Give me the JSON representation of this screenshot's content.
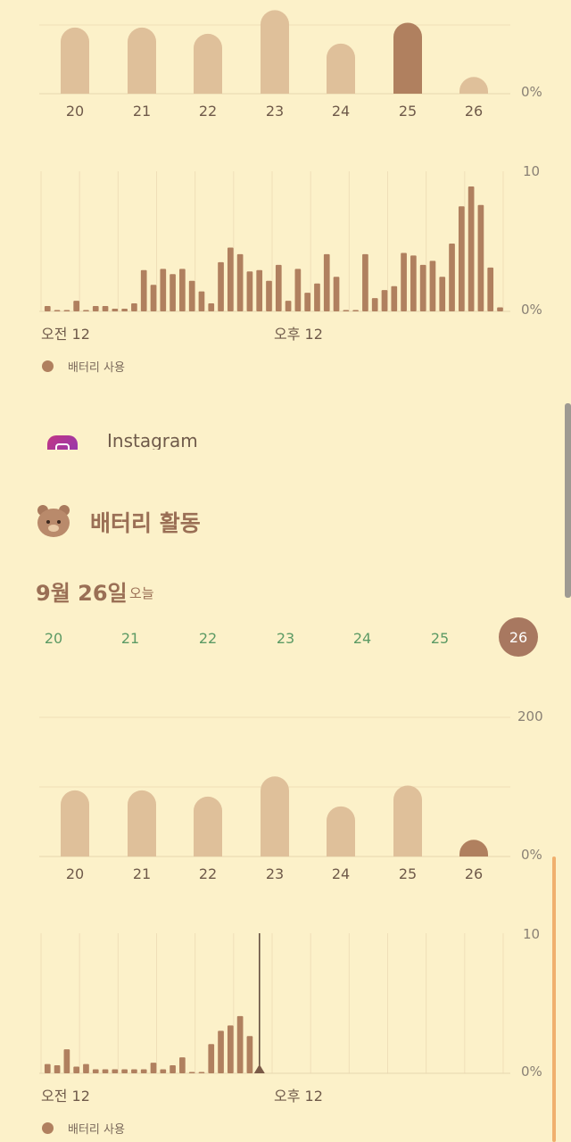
{
  "colors": {
    "background": "#fcf1c9",
    "bar_light": "#dfc09a",
    "bar_dark": "#b0805f",
    "hourly_bar": "#b0805f",
    "grid": "#efdfb8",
    "green_text": "#5c9a64",
    "accent_orange": "#f0b06e"
  },
  "top_section": {
    "weekly_chart": {
      "days": [
        "20",
        "21",
        "22",
        "23",
        "24",
        "25",
        "26"
      ],
      "values": [
        95,
        95,
        86,
        120,
        72,
        102,
        24
      ],
      "selected_index": 5,
      "max": 200,
      "y_min_label": "0%"
    },
    "hourly_chart": {
      "values": [
        0.4,
        0.1,
        0.1,
        0.8,
        0,
        0.4,
        0.4,
        0.2,
        0.2,
        0.6,
        3.1,
        2,
        3.2,
        2.8,
        3.2,
        2.3,
        1.5,
        0.6,
        3.7,
        4.8,
        4.3,
        3,
        3.1,
        2.3,
        3.5,
        0.8,
        3.2,
        1.4,
        2.1,
        4.3,
        2.6,
        0,
        0,
        4.3,
        1,
        1.6,
        1.9,
        4.4,
        4.2,
        3.5,
        3.8,
        2.6,
        5.1,
        7.9,
        9.4,
        8,
        3.3,
        0.3
      ],
      "y_max_label": "10",
      "y_min_label": "0%",
      "x_label_am": "오전 12",
      "x_label_pm": "오후 12"
    },
    "legend": "배터리 사용",
    "app_row": {
      "name": "Instagram",
      "icon": "instagram-icon"
    }
  },
  "battery_activity": {
    "header_icon": "bear-icon",
    "title": "배터리 활동",
    "date": "9월 26일",
    "today": "오늘",
    "day_selector": [
      "20",
      "21",
      "22",
      "23",
      "24",
      "25",
      "26"
    ],
    "selected_day": "26",
    "weekly_chart": {
      "days": [
        "20",
        "21",
        "22",
        "23",
        "24",
        "25",
        "26"
      ],
      "values": [
        95,
        95,
        86,
        115,
        72,
        102,
        24
      ],
      "selected_index": 6,
      "max": 200,
      "y_max_label": "200",
      "y_min_label": "0%"
    },
    "hourly_chart": {
      "values": [
        0.7,
        0.6,
        1.8,
        0.5,
        0.7,
        0.3,
        0.3,
        0.3,
        0.3,
        0.3,
        0.3,
        0.8,
        0.3,
        0.6,
        1.2,
        0.1,
        0,
        2.2,
        3.2,
        3.6,
        4.3,
        2.8
      ],
      "current_index": 22.5,
      "y_max_label": "10",
      "y_min_label": "0%",
      "x_label_am": "오전 12",
      "x_label_pm": "오후 12"
    },
    "legend": "배터리 사용"
  }
}
